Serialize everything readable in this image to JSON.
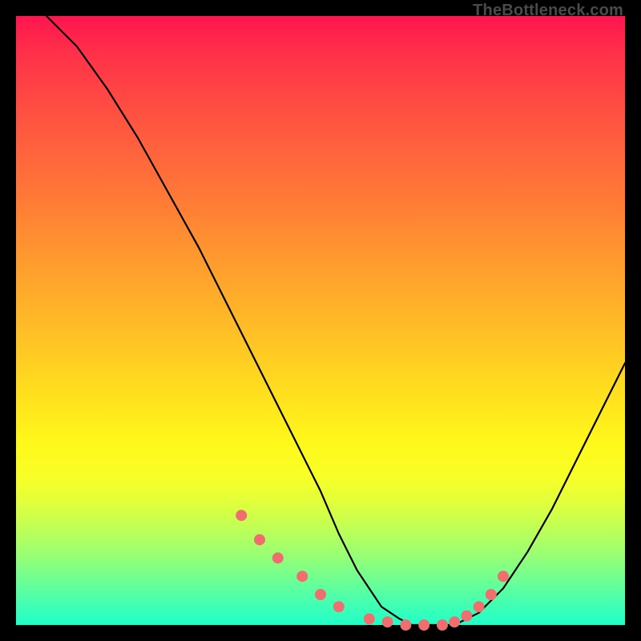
{
  "watermark": "TheBottleneck.com",
  "chart_data": {
    "type": "line",
    "title": "",
    "xlabel": "",
    "ylabel": "",
    "xlim": [
      0,
      100
    ],
    "ylim": [
      0,
      100
    ],
    "grid": false,
    "series": [
      {
        "name": "bottleneck-curve",
        "x": [
          5,
          10,
          15,
          20,
          25,
          30,
          35,
          40,
          45,
          50,
          53,
          56,
          60,
          63,
          65,
          68,
          72,
          76,
          80,
          84,
          88,
          92,
          96,
          100
        ],
        "values": [
          100,
          95,
          88,
          80,
          71,
          62,
          52,
          42,
          32,
          22,
          15,
          9,
          3,
          1,
          0,
          0,
          0,
          2,
          6,
          12,
          19,
          27,
          35,
          43
        ]
      }
    ],
    "markers": {
      "name": "highlight-points",
      "color": "#f06e6e",
      "x": [
        37,
        40,
        43,
        47,
        50,
        53,
        58,
        61,
        64,
        67,
        70,
        72,
        74,
        76,
        78,
        80
      ],
      "values": [
        18,
        14,
        11,
        8,
        5,
        3,
        1,
        0.5,
        0,
        0,
        0,
        0.5,
        1.5,
        3,
        5,
        8
      ]
    }
  }
}
